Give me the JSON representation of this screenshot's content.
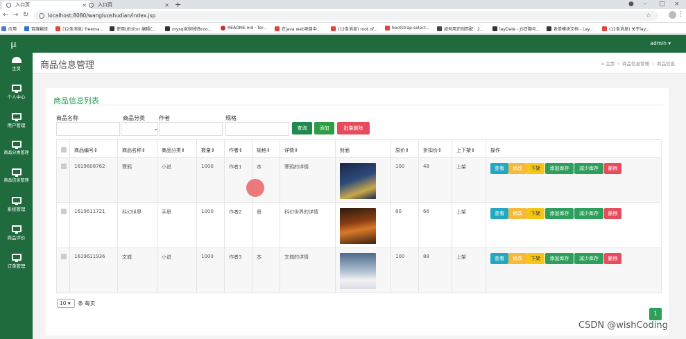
{
  "browser": {
    "tabs": [
      {
        "label": "入口页",
        "active": true
      },
      {
        "label": "入口页",
        "active": false
      }
    ],
    "url": "localhost:8080/wangluoshudian/index.jsp",
    "bookmarks": [
      "应用",
      "百度翻译",
      "(12条消息) freema...",
      "使用UEditor 编辑C...",
      "mysql如何修改roo...",
      "README.md · Ter...",
      "在java web项目中...",
      "(12条消息) root of...",
      "bootstrap-select...",
      "如何用正则匹配：2...",
      "layDate - JS日期与...",
      "表单模块文档 - Lay...",
      "(12条消息) 关于lay..."
    ]
  },
  "app": {
    "logo": "μ",
    "user": "admin",
    "sidebar": [
      {
        "label": "主页",
        "icon": "dashboard-icon"
      },
      {
        "label": "个人中心",
        "icon": "monitor-icon"
      },
      {
        "label": "用户管理",
        "icon": "monitor-icon"
      },
      {
        "label": "商品分类管理",
        "icon": "monitor-icon"
      },
      {
        "label": "商品信息管理",
        "icon": "monitor-icon"
      },
      {
        "label": "系统管理",
        "icon": "monitor-icon"
      },
      {
        "label": "商品评价",
        "icon": "monitor-icon"
      },
      {
        "label": "订单管理",
        "icon": "monitor-icon"
      }
    ],
    "page_title": "商品信息管理",
    "breadcrumb": [
      "主页",
      "商品信息管理",
      "商品信息"
    ]
  },
  "card": {
    "title": "商品信息列表",
    "filters": {
      "name": "商品名称",
      "category": "商品分类",
      "author": "作者",
      "spec": "规格"
    },
    "buttons": {
      "search": "查询",
      "add": "添加",
      "batch_delete": "批量删除"
    }
  },
  "table": {
    "headers": [
      "商品编号",
      "商品名称",
      "商品分类",
      "数量",
      "作者",
      "规格",
      "详情",
      "封面",
      "原价",
      "折扣价",
      "上下架",
      "操作"
    ],
    "rows": [
      {
        "id": "1619608762",
        "name": "寒鸦",
        "category": "小说",
        "qty": "1000",
        "author": "作者1",
        "spec": "本",
        "detail": "寒鸦的详情",
        "price": "100",
        "discount": "48",
        "status": "上架"
      },
      {
        "id": "1619611721",
        "name": "科幻世界",
        "category": "手册",
        "qty": "1000",
        "author": "作者2",
        "spec": "册",
        "detail": "科幻世界的详情",
        "price": "80",
        "discount": "66",
        "status": "上架"
      },
      {
        "id": "1619611936",
        "name": "文城",
        "category": "小说",
        "qty": "1000",
        "author": "作者3",
        "spec": "本",
        "detail": "文城的详情",
        "price": "100",
        "discount": "88",
        "status": "上架"
      }
    ],
    "actions": {
      "view": "查看",
      "edit": "修改",
      "down": "下架",
      "add_stock": "添加库存",
      "reduce_stock": "减少库存",
      "delete": "删除"
    }
  },
  "pagination": {
    "page_size": "10",
    "suffix": "条 每页",
    "current": "1"
  },
  "watermark": "CSDN @wishCoding"
}
